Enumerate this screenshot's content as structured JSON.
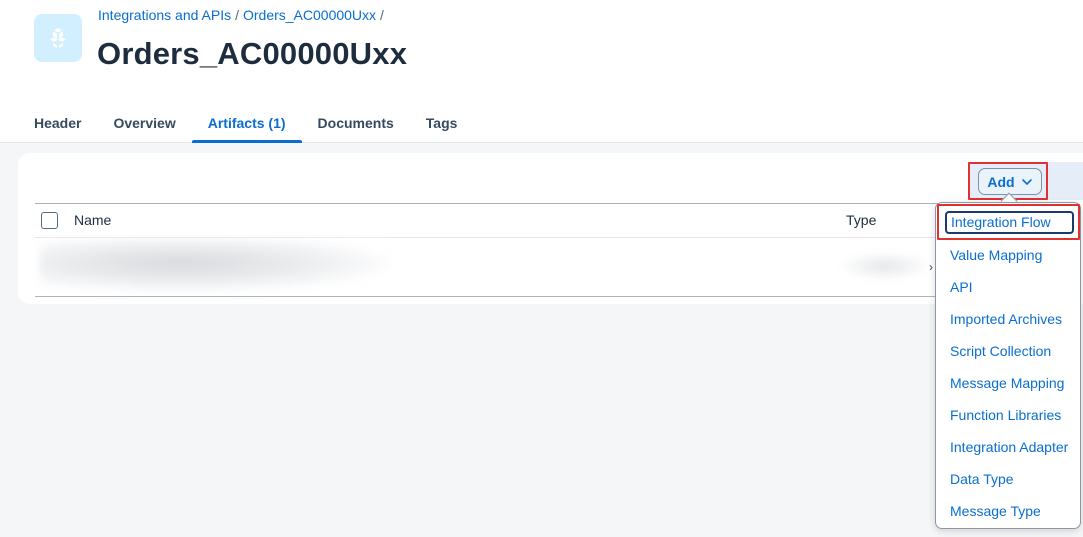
{
  "breadcrumb": {
    "items": [
      "Integrations and APIs",
      "Orders_AC00000Uxx"
    ],
    "separator": "/"
  },
  "page": {
    "title": "Orders_AC00000Uxx",
    "icon": "package-icon"
  },
  "tabs": [
    {
      "label": "Header"
    },
    {
      "label": "Overview"
    },
    {
      "label": "Artifacts (1)",
      "active": true
    },
    {
      "label": "Documents"
    },
    {
      "label": "Tags"
    }
  ],
  "toolbar": {
    "add_label": "Add"
  },
  "table": {
    "columns": [
      "Name",
      "Type"
    ],
    "row_action": "›"
  },
  "add_menu": {
    "items": [
      "Integration Flow",
      "Value Mapping",
      "API",
      "Imported Archives",
      "Script Collection",
      "Message Mapping",
      "Function Libraries",
      "Integration Adapter",
      "Data Type",
      "Message Type"
    ]
  },
  "colors": {
    "accent": "#0a6ed1",
    "highlight": "#e03131",
    "title": "#1d2d3e"
  }
}
